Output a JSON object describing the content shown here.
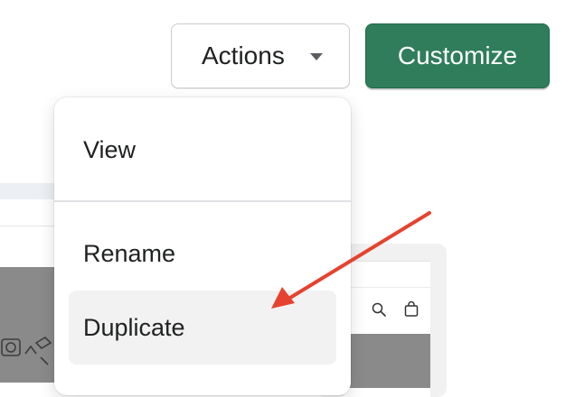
{
  "header": {
    "actions_label": "Actions",
    "customize_label": "Customize"
  },
  "actions_menu": {
    "items": [
      {
        "label": "View"
      },
      {
        "label": "Rename"
      },
      {
        "label": "Duplicate"
      }
    ],
    "highlighted": "Duplicate"
  },
  "icons": {
    "actions_caret": "caret-down-icon",
    "preview_search": "search-icon",
    "preview_cart": "cart-icon"
  },
  "colors": {
    "customize_bg": "#2f7d5b",
    "annotation_arrow": "#e5432f",
    "highlight_bg": "#f2f2f2"
  }
}
